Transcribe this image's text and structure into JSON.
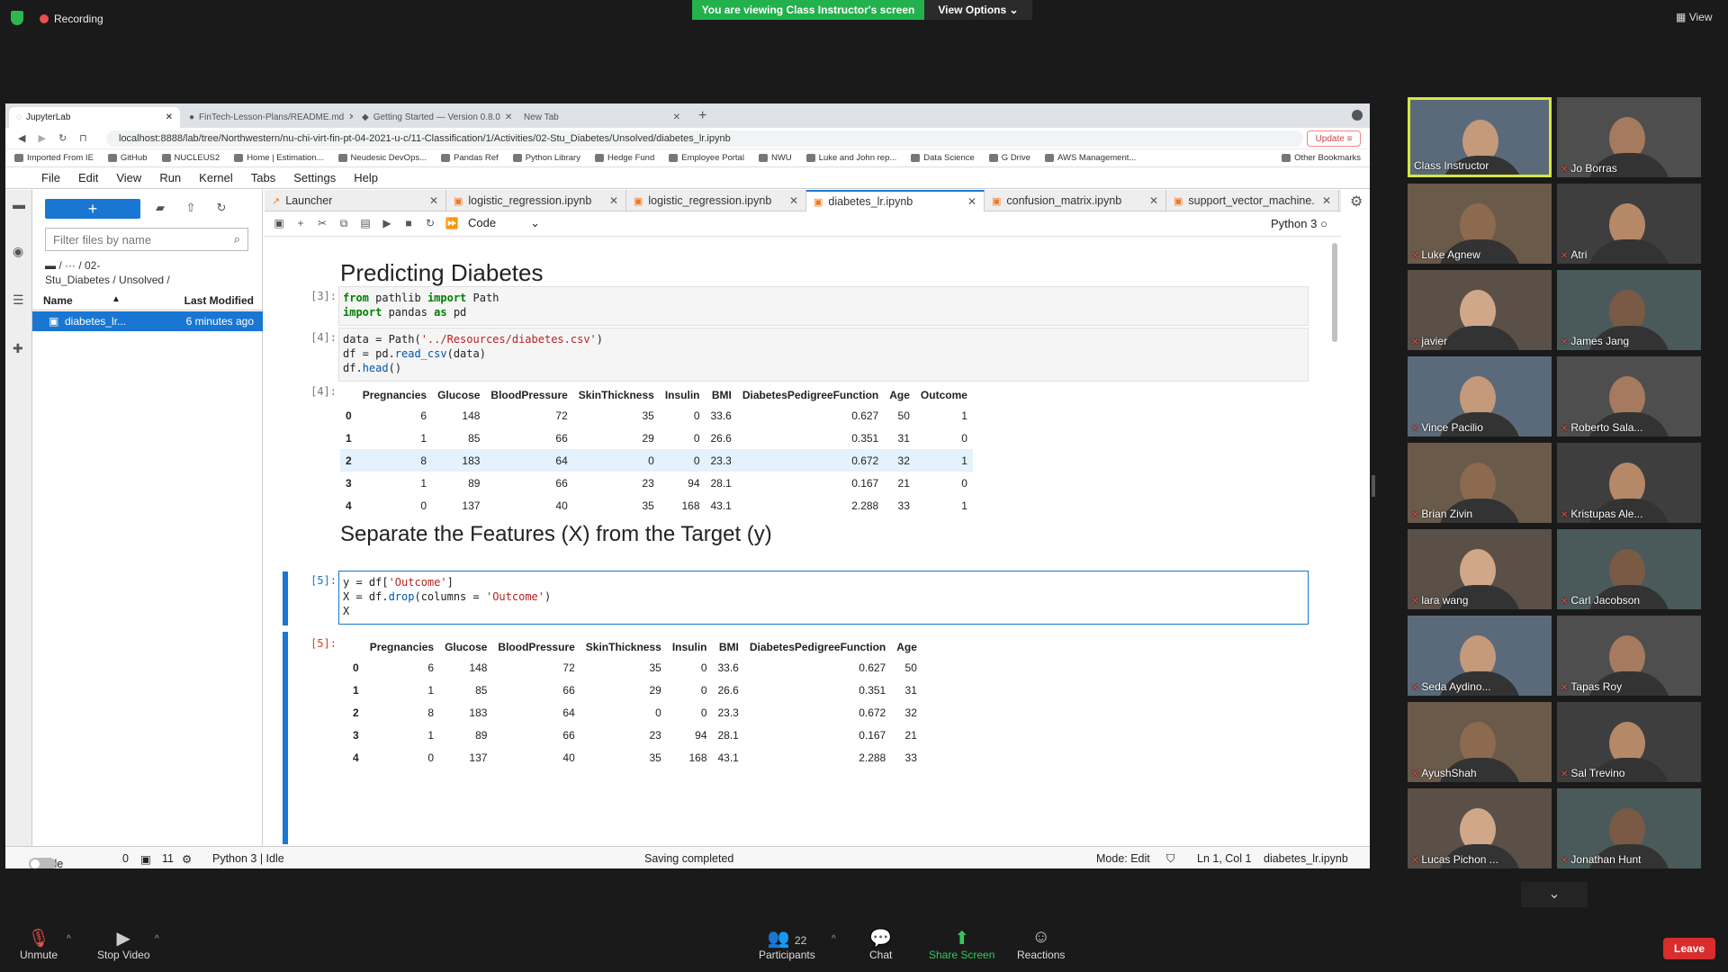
{
  "zoom": {
    "recording": "Recording",
    "banner": "You are viewing Class Instructor's screen",
    "view_options": "View Options",
    "view": "View",
    "unmute": "Unmute",
    "stop_video": "Stop Video",
    "participants": "Participants",
    "participants_count": "22",
    "chat": "Chat",
    "share_screen": "Share Screen",
    "reactions": "Reactions",
    "leave": "Leave"
  },
  "browser": {
    "tabs": [
      "JupyterLab",
      "FinTech-Lesson-Plans/README.md",
      "Getting Started — Version 0.8.0",
      "New Tab"
    ],
    "url": "localhost:8888/lab/tree/Northwestern/nu-chi-virt-fin-pt-04-2021-u-c/11-Classification/1/Activities/02-Stu_Diabetes/Unsolved/diabetes_lr.ipynb",
    "update": "Update",
    "bookmarks": [
      "Imported From IE",
      "GitHub",
      "NUCLEUS2",
      "Home | Estimation...",
      "Neudesic DevOps...",
      "Pandas Ref",
      "Python Library",
      "Hedge Fund",
      "Employee Portal",
      "NWU",
      "Luke and John rep...",
      "Data Science",
      "G Drive",
      "AWS Management..."
    ],
    "other_bookmarks": "Other Bookmarks"
  },
  "jupyter": {
    "menu": [
      "File",
      "Edit",
      "View",
      "Run",
      "Kernel",
      "Tabs",
      "Settings",
      "Help"
    ],
    "filter_placeholder": "Filter files by name",
    "crumb1": "/ ··· / 02-",
    "crumb2": "Stu_Diabetes / Unsolved /",
    "col_name": "Name",
    "col_modified": "Last Modified",
    "file_name": "diabetes_lr...",
    "file_modified": "6 minutes ago",
    "nb_tabs": [
      "Launcher",
      "logistic_regression.ipynb",
      "logistic_regression.ipynb",
      "diabetes_lr.ipynb",
      "confusion_matrix.ipynb",
      "support_vector_machine."
    ],
    "cell_type": "Code",
    "kernel": "Python 3",
    "h_predict": "Predicting Diabetes",
    "h_separate": "Separate the Features (X) from the Target (y)",
    "p3": "[3]:",
    "p4": "[4]:",
    "p4o": "[4]:",
    "p5": "[5]:",
    "p5o": "[5]:",
    "status": {
      "simple": "Simple",
      "zero": "0",
      "eleven": "11",
      "kernel": "Python 3 | Idle",
      "saving": "Saving completed",
      "mode": "Mode: Edit",
      "pos": "Ln 1, Col 1",
      "file": "diabetes_lr.ipynb"
    }
  },
  "table1": {
    "headers": [
      "",
      "Pregnancies",
      "Glucose",
      "BloodPressure",
      "SkinThickness",
      "Insulin",
      "BMI",
      "DiabetesPedigreeFunction",
      "Age",
      "Outcome"
    ],
    "rows": [
      [
        "0",
        "6",
        "148",
        "72",
        "35",
        "0",
        "33.6",
        "0.627",
        "50",
        "1"
      ],
      [
        "1",
        "1",
        "85",
        "66",
        "29",
        "0",
        "26.6",
        "0.351",
        "31",
        "0"
      ],
      [
        "2",
        "8",
        "183",
        "64",
        "0",
        "0",
        "23.3",
        "0.672",
        "32",
        "1"
      ],
      [
        "3",
        "1",
        "89",
        "66",
        "23",
        "94",
        "28.1",
        "0.167",
        "21",
        "0"
      ],
      [
        "4",
        "0",
        "137",
        "40",
        "35",
        "168",
        "43.1",
        "2.288",
        "33",
        "1"
      ]
    ]
  },
  "table2": {
    "headers": [
      "",
      "Pregnancies",
      "Glucose",
      "BloodPressure",
      "SkinThickness",
      "Insulin",
      "BMI",
      "DiabetesPedigreeFunction",
      "Age"
    ],
    "rows": [
      [
        "0",
        "6",
        "148",
        "72",
        "35",
        "0",
        "33.6",
        "0.627",
        "50"
      ],
      [
        "1",
        "1",
        "85",
        "66",
        "29",
        "0",
        "26.6",
        "0.351",
        "31"
      ],
      [
        "2",
        "8",
        "183",
        "64",
        "0",
        "0",
        "23.3",
        "0.672",
        "32"
      ],
      [
        "3",
        "1",
        "89",
        "66",
        "23",
        "94",
        "28.1",
        "0.167",
        "21"
      ],
      [
        "4",
        "0",
        "137",
        "40",
        "35",
        "168",
        "43.1",
        "2.288",
        "33"
      ]
    ]
  },
  "participants": [
    "Class Instructor",
    "Jo Borras",
    "Luke Agnew",
    "Atri",
    "javier",
    "James Jang",
    "Vince Pacilio",
    "Roberto Sala...",
    "Brian Zivin",
    "Kristupas Ale...",
    "lara wang",
    "Carl Jacobson",
    "Seda Aydino...",
    "Tapas Roy",
    "AyushShah",
    "Sal Trevino",
    "Lucas Pichon ...",
    "Jonathan Hunt"
  ]
}
